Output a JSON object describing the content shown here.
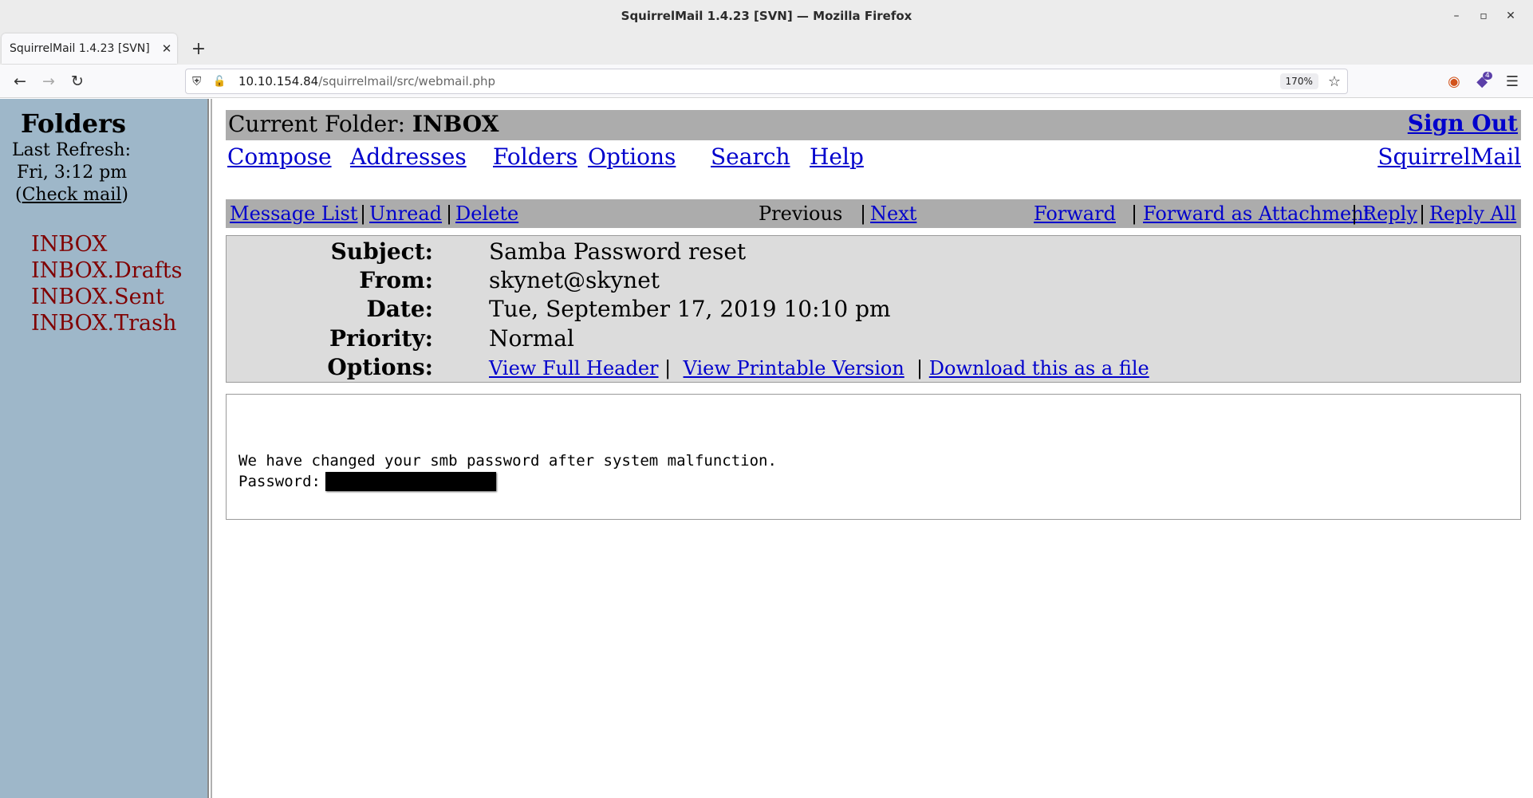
{
  "window": {
    "title": "SquirrelMail 1.4.23 [SVN] — Mozilla Firefox"
  },
  "tab": {
    "label": "SquirrelMail 1.4.23 [SVN]"
  },
  "urlbar": {
    "host": "10.10.154.84",
    "path": "/squirrelmail/src/webmail.php",
    "zoom": "170%"
  },
  "extensions": {
    "badge": "4"
  },
  "sidebar": {
    "heading": "Folders",
    "last_refresh_label": "Last Refresh:",
    "last_refresh_time": "Fri, 3:12 pm",
    "check_mail": "Check mail",
    "folders": [
      "INBOX",
      "INBOX.Drafts",
      "INBOX.Sent",
      "INBOX.Trash"
    ]
  },
  "topbar": {
    "current_folder_label": "Current Folder:",
    "current_folder": "INBOX",
    "sign_out": "Sign Out"
  },
  "menu": {
    "compose": "Compose",
    "addresses": "Addresses",
    "folders": "Folders",
    "options": "Options",
    "search": "Search",
    "help": "Help",
    "brand": "SquirrelMail"
  },
  "msgnav": {
    "message_list": "Message List",
    "unread": "Unread",
    "delete": "Delete",
    "previous": "Previous",
    "next": "Next",
    "forward": "Forward",
    "forward_attachment": "Forward as Attachment",
    "reply": "Reply",
    "reply_all": "Reply All",
    "sep": "|"
  },
  "headers": {
    "subject_label": "Subject:",
    "subject": "Samba Password reset",
    "from_label": "From:",
    "from": "skynet@skynet",
    "date_label": "Date:",
    "date": "Tue, September 17, 2019 10:10 pm",
    "priority_label": "Priority:",
    "priority": "Normal",
    "options_label": "Options:",
    "view_full_header": "View Full Header",
    "view_printable": "View Printable Version",
    "download": "Download this as a file"
  },
  "body": {
    "line1": "We have changed your smb password after system malfunction.",
    "password_label": "Password:"
  }
}
